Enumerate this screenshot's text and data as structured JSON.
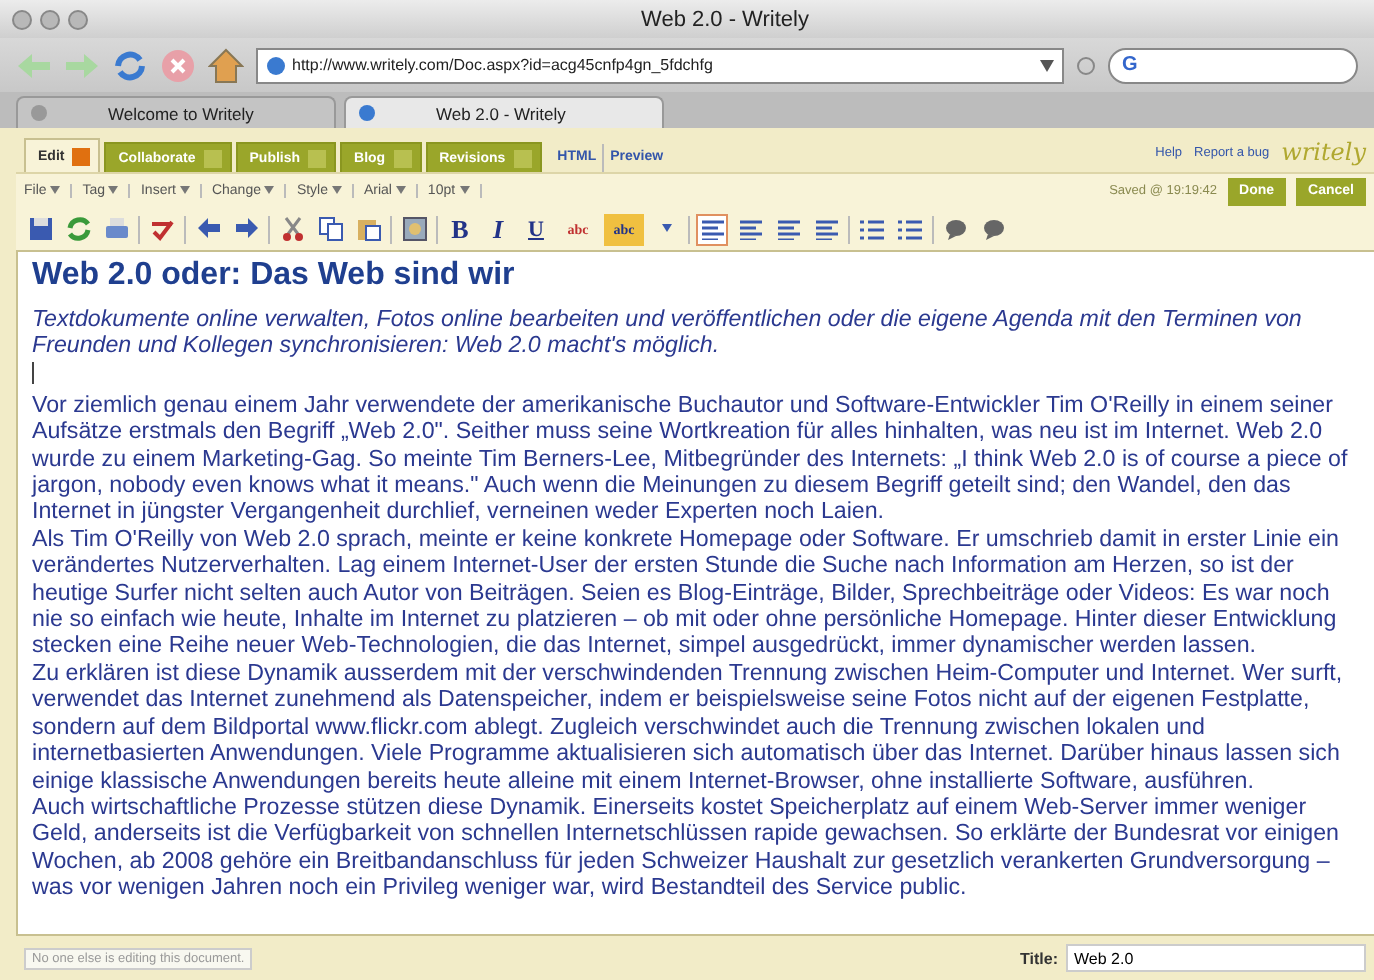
{
  "window": {
    "title": "Web 2.0 - Writely"
  },
  "address_bar": {
    "value": "http://www.writely.com/Doc.aspx?id=acg45cnfp4gn_5fdchfg"
  },
  "search": {
    "value": "G"
  },
  "browser_tabs": [
    {
      "label": "Welcome to Writely",
      "selected": false
    },
    {
      "label": "Web 2.0 - Writely",
      "selected": true
    }
  ],
  "app_tabs": [
    {
      "label": "Edit",
      "selected": true
    },
    {
      "label": "Collaborate",
      "selected": false
    },
    {
      "label": "Publish",
      "selected": false
    },
    {
      "label": "Blog",
      "selected": false
    },
    {
      "label": "Revisions",
      "selected": false
    }
  ],
  "view_links": [
    "HTML",
    "Preview"
  ],
  "header_links": [
    "Help",
    "Report a bug"
  ],
  "logo": "writely",
  "menus": [
    "File",
    "Tag",
    "Insert",
    "Change",
    "Style",
    "Arial",
    "10pt"
  ],
  "saved_status": "Saved @ 19:19:42",
  "action_buttons": [
    "Done",
    "Cancel"
  ],
  "toolbar": [
    {
      "kind": "save"
    },
    {
      "kind": "refresh"
    },
    {
      "kind": "print"
    },
    {
      "kind": "sep"
    },
    {
      "kind": "spell"
    },
    {
      "kind": "sep"
    },
    {
      "kind": "undo"
    },
    {
      "kind": "redo"
    },
    {
      "kind": "sep"
    },
    {
      "kind": "cut"
    },
    {
      "kind": "copy"
    },
    {
      "kind": "paste"
    },
    {
      "kind": "sep"
    },
    {
      "kind": "image"
    },
    {
      "kind": "sep"
    },
    {
      "kind": "bold",
      "label": "B"
    },
    {
      "kind": "italic",
      "label": "I"
    },
    {
      "kind": "underline",
      "label": "U"
    },
    {
      "kind": "color",
      "label": "abc"
    },
    {
      "kind": "highlight",
      "label": "abc"
    },
    {
      "kind": "more"
    },
    {
      "kind": "sep"
    },
    {
      "kind": "align",
      "selected": true
    },
    {
      "kind": "align",
      "selected": false
    },
    {
      "kind": "align",
      "selected": false
    },
    {
      "kind": "align",
      "selected": false
    },
    {
      "kind": "sep"
    },
    {
      "kind": "list"
    },
    {
      "kind": "list"
    },
    {
      "kind": "sep"
    },
    {
      "kind": "comment"
    },
    {
      "kind": "comment"
    }
  ],
  "document": {
    "heading": "Web 2.0 oder: Das Web sind wir",
    "lead": "Textdokumente online verwalten, Fotos online bearbeiten und veröffentlichen oder die eigene Agenda mit den Terminen von Freunden und Kollegen synchronisieren: Web 2.0 macht's möglich.",
    "paragraphs": [
      "Vor ziemlich genau einem Jahr verwendete der amerikanische Buchautor und Software-Entwickler Tim O'Reilly in einem seiner Aufsätze erstmals den Begriff „Web 2.0\". Seither muss seine Wortkreation für alles hinhalten, was neu ist im Internet. Web 2.0 wurde zu einem Marketing-Gag. So meinte Tim Berners-Lee, Mitbegründer des Internets: „I think Web 2.0 is of course a piece of jargon, nobody even knows what it means.\" Auch wenn die Meinungen zu diesem Begriff geteilt sind; den Wandel, den das Internet in jüngster Vergangenheit durchlief, verneinen weder Experten noch Laien.",
      "Als Tim O'Reilly von Web 2.0 sprach, meinte er keine konkrete Homepage oder Software. Er umschrieb damit in erster Linie ein verändertes Nutzerverhalten. Lag einem Internet-User der ersten Stunde die Suche nach Information am Herzen, so ist der heutige Surfer nicht selten auch Autor von Beiträgen. Seien es Blog-Einträge, Bilder, Sprechbeiträge oder Videos: Es war noch nie so einfach wie heute, Inhalte im Internet zu platzieren – ob mit oder ohne persönliche Homepage. Hinter dieser Entwicklung stecken eine Reihe neuer Web-Technologien, die das Internet, simpel ausgedrückt, immer dynamischer werden lassen.",
      "Zu erklären ist diese Dynamik ausserdem mit der verschwindenden Trennung zwischen Heim-Computer und Internet. Wer surft, verwendet das Internet zunehmend als Datenspeicher, indem er beispielsweise seine Fotos nicht auf der eigenen Festplatte, sondern auf dem Bildportal www.flickr.com ablegt. Zugleich verschwindet auch die Trennung zwischen lokalen und internetbasierten Anwendungen. Viele Programme aktualisieren sich automatisch über das Internet. Darüber hinaus lassen sich einige klassische Anwendungen bereits heute alleine mit einem Internet-Browser, ohne installierte Software, ausführen.",
      "Auch wirtschaftliche Prozesse stützen diese Dynamik. Einerseits kostet Speicherplatz auf einem Web-Server immer weniger Geld, anderseits ist die Verfügbarkeit von schnellen Internetschlüssen rapide gewachsen. So erklärte der Bundesrat vor einigen Wochen, ab 2008 gehöre ein Breitbandanschluss für jeden Schweizer Haushalt zur gesetzlich verankerten Grundversorgung – was vor wenigen Jahren noch ein Privileg weniger war, wird Bestandteil des Service public."
    ]
  },
  "status_bar": {
    "message": "No one else is editing this document.",
    "title_label": "Title:",
    "title_value": "Web 2.0"
  }
}
